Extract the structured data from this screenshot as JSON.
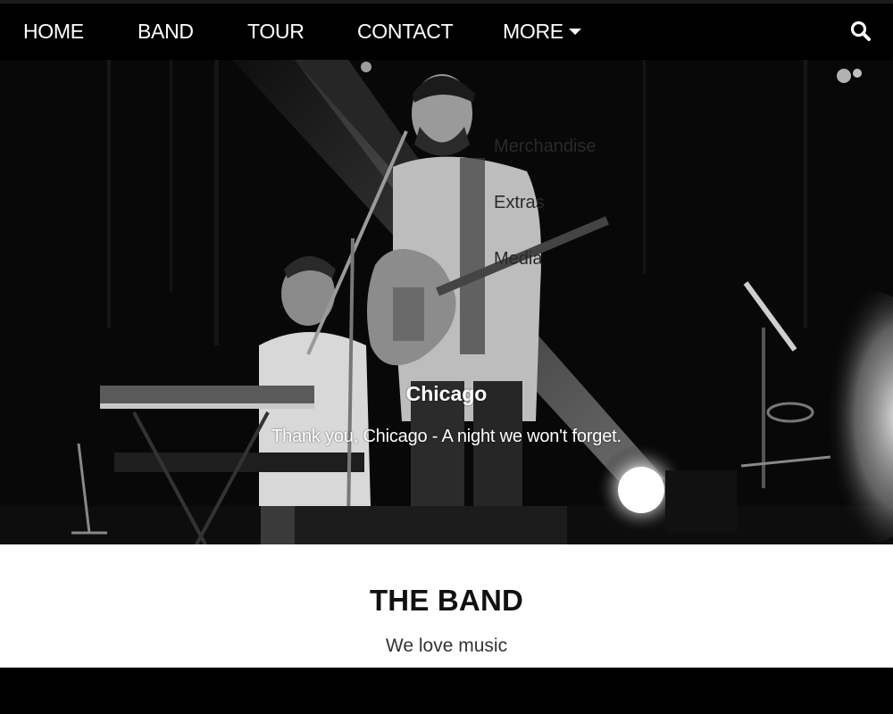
{
  "nav": {
    "home": "HOME",
    "band": "BAND",
    "tour": "TOUR",
    "contact": "CONTACT",
    "more": "MORE",
    "search_icon": "search-icon"
  },
  "dropdown": {
    "items": [
      "Merchandise",
      "Extras",
      "Media"
    ]
  },
  "hero": {
    "city": "Chicago",
    "text": "Thank you, Chicago - A night we won't forget."
  },
  "band": {
    "title": "THE BAND",
    "subtitle": "We love music"
  },
  "colors": {
    "navbar": "#000000",
    "section": "#ffffff"
  }
}
